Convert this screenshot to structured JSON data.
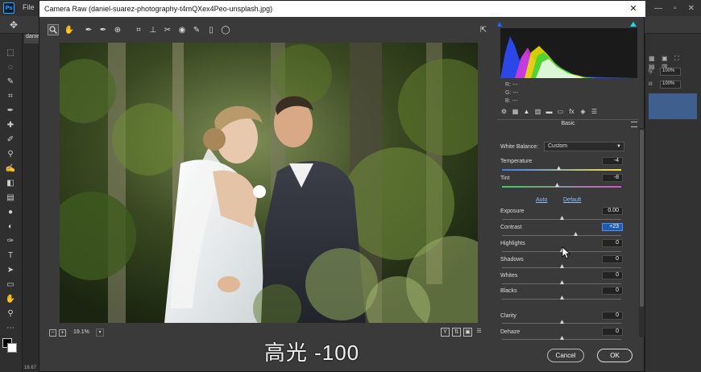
{
  "ps": {
    "logo": "Ps",
    "menu_file": "File",
    "doc_tab": "danie",
    "zoom_readout": "16.67",
    "right_panel": {
      "zoom_a_label": "ty:",
      "zoom_a_value": "100%",
      "zoom_b_label": "ill:",
      "zoom_b_value": "100%"
    }
  },
  "acr": {
    "title": "Camera Raw (daniel-suarez-photography-t4mQXex4Peo-unsplash.jpg)",
    "zoom_value": "19.1%",
    "rgb": {
      "r": "R:   ---",
      "g": "G:   ---",
      "b": "B:   ---"
    },
    "panel_title": "Basic",
    "white_balance_label": "White Balance:",
    "white_balance_value": "Custom",
    "auto_label": "Auto",
    "default_label": "Default",
    "sliders": [
      {
        "label": "Temperature",
        "value": "-4"
      },
      {
        "label": "Tint",
        "value": "-8"
      },
      {
        "label": "Exposure",
        "value": "0.00"
      },
      {
        "label": "Contrast",
        "value": "+23"
      },
      {
        "label": "Highlights",
        "value": "0"
      },
      {
        "label": "Shadows",
        "value": "0"
      },
      {
        "label": "Whites",
        "value": "0"
      },
      {
        "label": "Blacks",
        "value": "0"
      },
      {
        "label": "Clarity",
        "value": "0"
      },
      {
        "label": "Dehaze",
        "value": "0"
      }
    ],
    "cancel_label": "Cancel",
    "ok_label": "OK"
  },
  "subtitle": "高光 -100",
  "colors": {
    "accent": "#1f5bb3",
    "link": "#8ec0ff",
    "ps_blue": "#31a8ff"
  }
}
